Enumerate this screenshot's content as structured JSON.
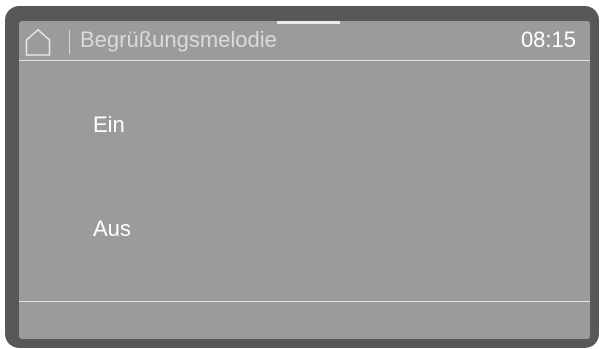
{
  "header": {
    "home_icon": "home-icon",
    "title": "Begrüßungsmelodie",
    "time": "08:15"
  },
  "options": [
    {
      "label": "Ein"
    },
    {
      "label": "Aus"
    }
  ],
  "colors": {
    "bezel": "#58585a",
    "screen": "#9a9b9c",
    "text": "#ffffff",
    "line": "#e2e2e2"
  }
}
